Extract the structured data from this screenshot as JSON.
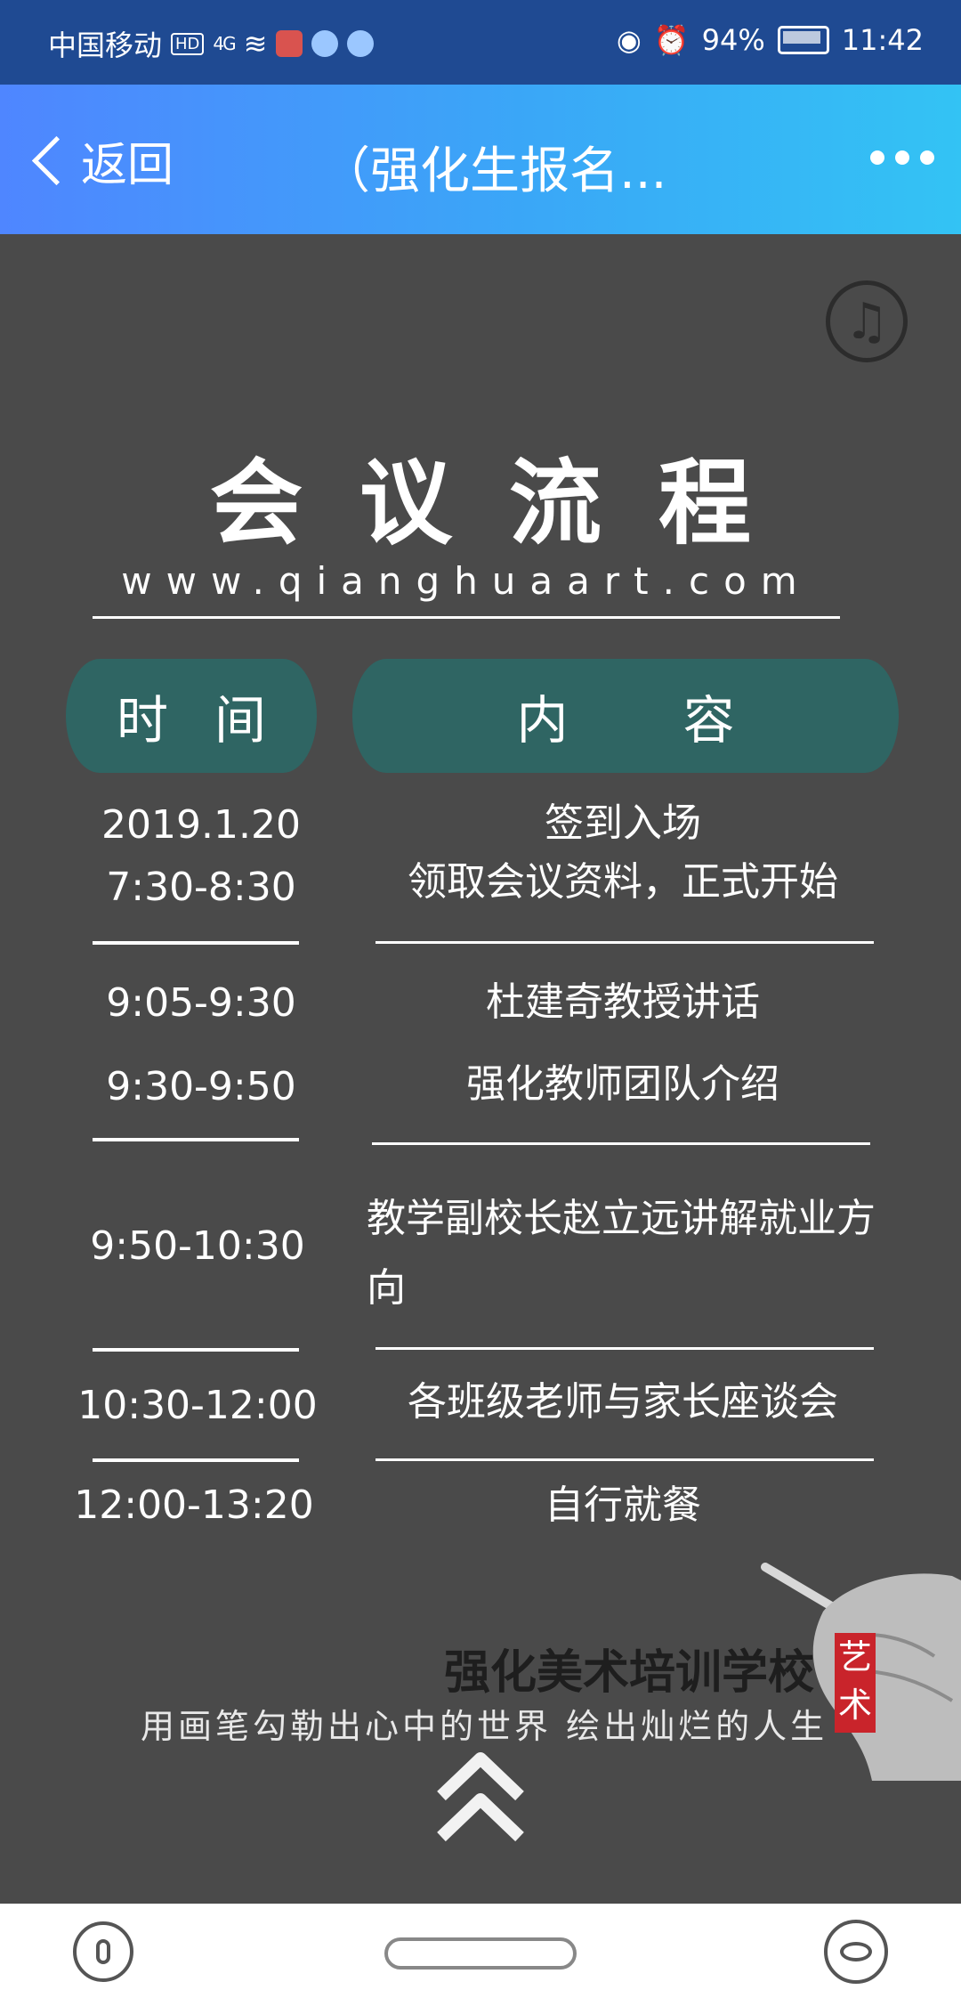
{
  "status_bar": {
    "carrier": "中国移动",
    "hd": "HD",
    "network": "4G",
    "battery": "94%",
    "time": "11:42"
  },
  "nav": {
    "back_label": "返回",
    "title": "（强化生报名..."
  },
  "main": {
    "heading": "会议流程",
    "url": "www.qianghuaart.com",
    "col_time": "时间",
    "col_content_1": "内",
    "col_content_2": "容",
    "rows": [
      {
        "time_1": "2019.1.20",
        "time_2": "7:30-8:30",
        "content_1": "签到入场",
        "content_2": "领取会议资料，正式开始"
      },
      {
        "time_1": "9:05-9:30",
        "time_2": "9:30-9:50",
        "content_1": "杜建奇教授讲话",
        "content_2": "强化教师团队介绍"
      },
      {
        "time_1": "9:50-10:30",
        "content_1": "教学副校长赵立远讲解就业方",
        "content_2": "向"
      },
      {
        "time_1": "10:30-12:00",
        "content_1": "各班级老师与家长座谈会"
      },
      {
        "time_1": "12:00-13:20",
        "content_1": "自行就餐"
      }
    ],
    "school_name": "强化美术培训学校",
    "slogan": "用画笔勾勒出心中的世界   绘出灿烂的人生",
    "seal_1": "艺",
    "seal_2": "术"
  }
}
